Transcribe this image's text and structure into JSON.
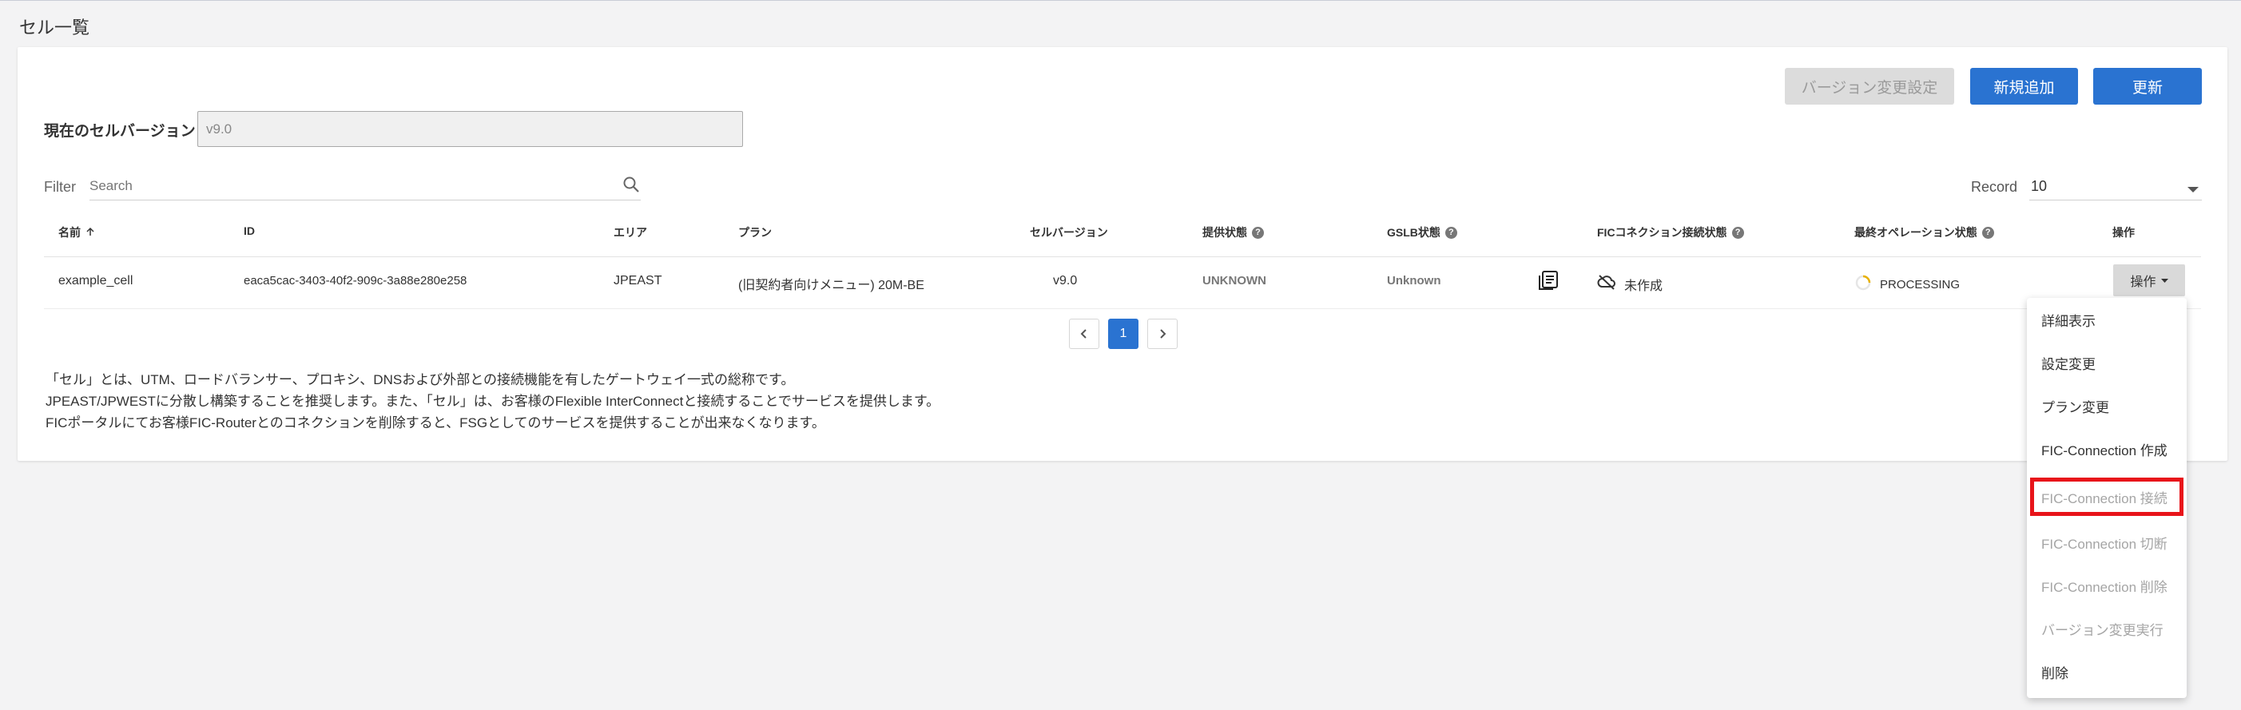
{
  "page": {
    "title": "セル一覧"
  },
  "toolbar": {
    "version_setting_label": "バージョン変更設定",
    "add_label": "新規追加",
    "refresh_label": "更新"
  },
  "version": {
    "label": "現在のセルバージョン",
    "value": "v9.0"
  },
  "filter": {
    "label": "Filter",
    "placeholder": "Search"
  },
  "record": {
    "label": "Record",
    "value": "10"
  },
  "table": {
    "headers": {
      "name": "名前",
      "id": "ID",
      "area": "エリア",
      "plan": "プラン",
      "cell_version": "セルバージョン",
      "provision_status": "提供状態",
      "gslb_status": "GSLB状態",
      "fic_status": "FICコネクション接続状態",
      "last_op_status": "最終オペレーション状態",
      "actions": "操作"
    },
    "row": {
      "name": "example_cell",
      "id": "eaca5cac-3403-40f2-909c-3a88e280e258",
      "area": "JPEAST",
      "plan": "(旧契約者向けメニュー) 20M-BE",
      "cell_version": "v9.0",
      "provision_status": "UNKNOWN",
      "gslb_status": "Unknown",
      "fic_status": "未作成",
      "last_op_status": "PROCESSING",
      "actions_label": "操作"
    }
  },
  "pagination": {
    "current": "1"
  },
  "description": {
    "line1": "「セル」とは、UTM、ロードバランサー、プロキシ、DNSおよび外部との接続機能を有したゲートウェイ一式の総称です。",
    "line2": "JPEAST/JPWESTに分散し構築することを推奨します。また、「セル」は、お客様のFlexible InterConnectと接続することでサービスを提供します。",
    "line3": "FICポータルにてお客様FIC-Routerとのコネクションを削除すると、FSGとしてのサービスを提供することが出来なくなります。"
  },
  "menu": {
    "items": [
      {
        "label": "詳細表示"
      },
      {
        "label": "設定変更"
      },
      {
        "label": "プラン変更"
      },
      {
        "label": "FIC-Connection 作成"
      },
      {
        "label": "FIC-Connection 接続"
      },
      {
        "label": "FIC-Connection 切断"
      },
      {
        "label": "FIC-Connection 削除"
      },
      {
        "label": "バージョン変更実行"
      },
      {
        "label": "削除"
      }
    ]
  },
  "colors": {
    "primary": "#2a73d1",
    "highlight": "#e8141a",
    "disabled": "#a5a5a5"
  }
}
